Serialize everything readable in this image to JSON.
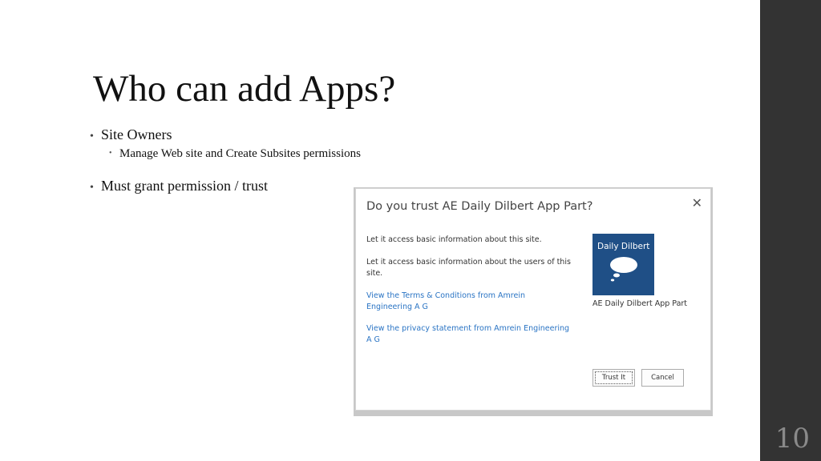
{
  "slide": {
    "title": "Who can add Apps?",
    "bullets": [
      {
        "text": "Site Owners",
        "sub": [
          "Manage Web site and Create Subsites permissions"
        ]
      },
      {
        "text": "Must grant permission / trust",
        "sub": []
      }
    ],
    "slide_number": "10",
    "colors": {
      "sidebar": "#333333",
      "title": "#111111"
    }
  },
  "dialog": {
    "title": "Do you trust AE Daily Dilbert App Part?",
    "close_icon": "close-icon",
    "texts": [
      "Let it access basic information about this site.",
      "Let it access basic information about the users of this site."
    ],
    "links": [
      "View the Terms & Conditions from Amrein Engineering A G",
      "View the privacy statement from Amrein Engineering A G"
    ],
    "app_tile": {
      "label": "Daily Dilbert",
      "icon": "speech-bubble-icon",
      "color": "#1f4f86"
    },
    "app_name": "AE Daily Dilbert App Part",
    "buttons": {
      "trust": "Trust It",
      "cancel": "Cancel"
    },
    "link_color": "#2a74c4"
  }
}
